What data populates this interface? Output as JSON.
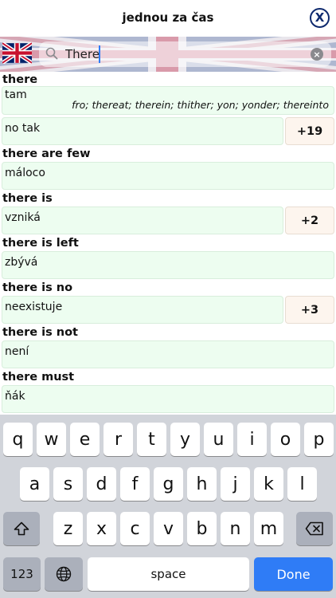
{
  "header": {
    "title": "jednou za čas",
    "close_label": "X"
  },
  "search": {
    "value": "There",
    "flag": "uk-flag-icon"
  },
  "entries": [
    {
      "head": "there",
      "translation": "tam",
      "synonyms": "fro; thereat; therein; thither; yon; yonder; thereinto",
      "more": ""
    },
    {
      "head": "",
      "translation": "no tak",
      "synonyms": "",
      "more": "+19"
    },
    {
      "head": "there are few",
      "translation": "máloco",
      "synonyms": "",
      "more": ""
    },
    {
      "head": "there is",
      "translation": "vzniká",
      "synonyms": "",
      "more": "+2"
    },
    {
      "head": "there is left",
      "translation": "zbývá",
      "synonyms": "",
      "more": ""
    },
    {
      "head": "there is no",
      "translation": "neexistuje",
      "synonyms": "",
      "more": "+3"
    },
    {
      "head": "there is not",
      "translation": "není",
      "synonyms": "",
      "more": ""
    },
    {
      "head": "there must",
      "translation": "ňák",
      "synonyms": "",
      "more": ""
    }
  ],
  "keyboard": {
    "row1": [
      "q",
      "w",
      "e",
      "r",
      "t",
      "y",
      "u",
      "i",
      "o",
      "p"
    ],
    "row2": [
      "a",
      "s",
      "d",
      "f",
      "g",
      "h",
      "j",
      "k",
      "l"
    ],
    "row3": [
      "z",
      "x",
      "c",
      "v",
      "b",
      "n",
      "m"
    ],
    "numbers_label": "123",
    "space_label": "space",
    "done_label": "Done"
  }
}
